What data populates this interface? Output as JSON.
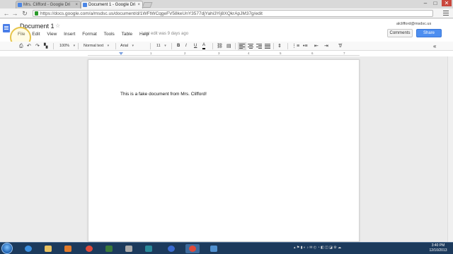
{
  "browser": {
    "tabs": [
      {
        "title": "Mrs. Clifford - Google Dri",
        "active": false
      },
      {
        "title": "Document 1 - Google Dri",
        "active": true
      }
    ],
    "url": "https://docs.google.com/a/msdsc.us/document/d/1WFtWCqgeFV58keUnY3577djYahi3Yij8XQkrApJM37g/edit",
    "window_controls": {
      "minimize": "–",
      "maximize": "□",
      "close": "✕"
    },
    "nav_icons": {
      "back": "←",
      "forward": "→",
      "reload": "↻"
    }
  },
  "docs": {
    "title": "Document 1",
    "star_icon": "☆",
    "account": "alclifford@msdsc.us",
    "comments_label": "Comments",
    "share_label": "Share",
    "menu": [
      "File",
      "Edit",
      "View",
      "Insert",
      "Format",
      "Tools",
      "Table",
      "Help"
    ],
    "last_edit": "Last edit was 9 days ago"
  },
  "toolbar": {
    "zoom": "100%",
    "style": "Normal text",
    "font": "Arial",
    "size": "11",
    "bold": "B",
    "italic": "I",
    "underline": "U",
    "text_color": "A",
    "collapse_icon": "«"
  },
  "ruler": {
    "numbers": [
      "1",
      "2",
      "3",
      "4",
      "5",
      "6",
      "7"
    ]
  },
  "document": {
    "body": "This is a fake document from Mrs. Clifford!"
  },
  "taskbar": {
    "time": "3:40 PM",
    "date": "12/10/2013"
  },
  "colors": {
    "accent": "#4d8ef0",
    "highlight": "#e6c44a",
    "taskbar": "#1c3a5c"
  }
}
